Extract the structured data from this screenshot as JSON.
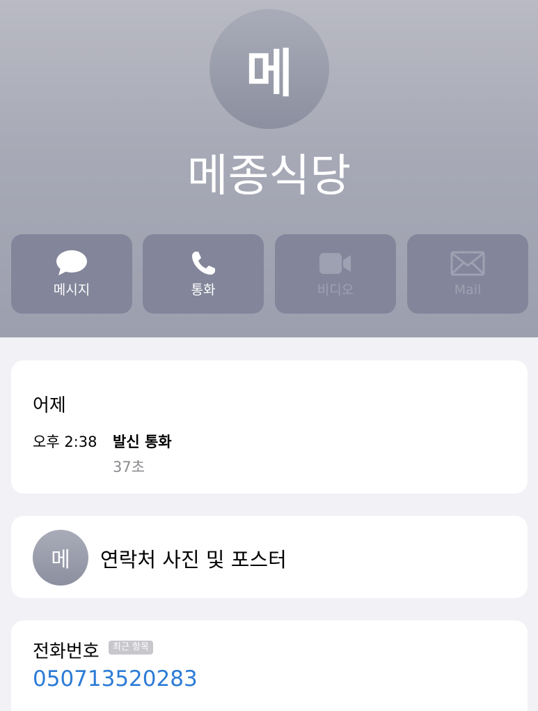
{
  "contact": {
    "initial": "메",
    "name": "메종식당"
  },
  "actions": [
    {
      "label": "메시지",
      "icon": "message-bubble-icon",
      "enabled": true
    },
    {
      "label": "통화",
      "icon": "phone-icon",
      "enabled": true
    },
    {
      "label": "비디오",
      "icon": "video-camera-icon",
      "enabled": false
    },
    {
      "label": "Mail",
      "icon": "mail-envelope-icon",
      "enabled": false
    }
  ],
  "recent_call": {
    "day": "어제",
    "time": "오후 2:38",
    "type": "발신 통화",
    "duration": "37초"
  },
  "photo_poster": {
    "initial": "메",
    "label": "연락처 사진 및 포스터"
  },
  "phone": {
    "label": "전화번호",
    "badge": "최근 항목",
    "number": "050713520283"
  },
  "colors": {
    "link": "#2c7bd6",
    "header_top": "#b9bac3",
    "header_bottom": "#9c9fae",
    "button": "#83869a",
    "background": "#f2f1f6"
  }
}
